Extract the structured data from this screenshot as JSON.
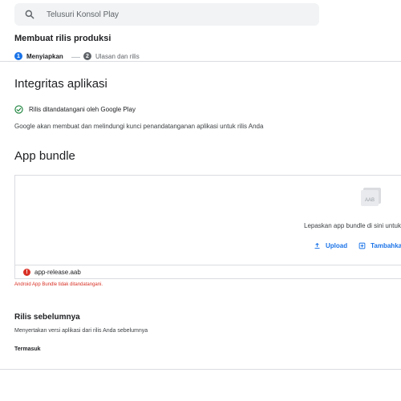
{
  "search": {
    "placeholder": "Telusuri Konsol Play",
    "icon": "search-icon"
  },
  "page_title": "Membuat rilis produksi",
  "stepper": [
    {
      "number": "1",
      "label": "Menyiapkan",
      "state": "active"
    },
    {
      "number": "2",
      "label": "Ulasan dan rilis",
      "state": "inactive"
    }
  ],
  "app_integrity": {
    "heading": "Integritas aplikasi",
    "signed_status": "Rilis ditandatangani oleh Google Play",
    "description": "Google akan membuat dan melindungi kunci penandatanganan aplikasi untuk rilis Anda"
  },
  "app_bundle": {
    "heading": "App bundle",
    "file_badge": "AAB",
    "drop_text": "Lepaskan app bundle di sini untuk",
    "upload_label": "Upload",
    "add_label": "Tambahkan",
    "file": {
      "name": "app-release.aab",
      "status": "error"
    },
    "error_message": "Android App Bundle tidak ditandatangani."
  },
  "previous_releases": {
    "heading": "Rilis sebelumnya",
    "description": "Menyertakan versi aplikasi dari rilis Anda sebelumnya",
    "included_label": "Termasuk"
  },
  "colors": {
    "accent": "#1a73e8",
    "success": "#188038",
    "error": "#d93025"
  }
}
